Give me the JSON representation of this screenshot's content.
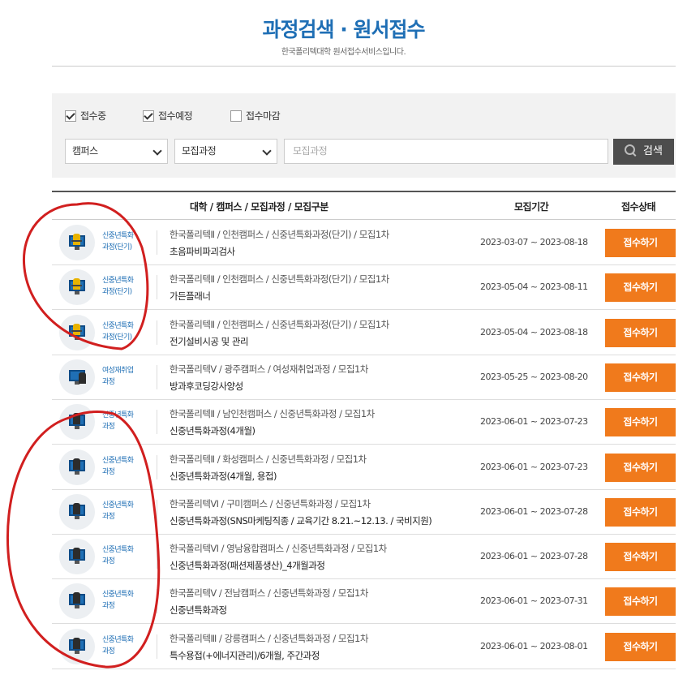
{
  "header": {
    "title": "과정검색 · 원서접수",
    "subtitle": "한국폴리텍대학 원서접수서비스입니다."
  },
  "search": {
    "checkboxes": [
      {
        "label": "접수중",
        "checked": true
      },
      {
        "label": "접수예정",
        "checked": true
      },
      {
        "label": "접수마감",
        "checked": false
      }
    ],
    "campus_select": "캠퍼스",
    "course_select": "모집과정",
    "keyword_placeholder": "모집과정",
    "button_label": "검색"
  },
  "table": {
    "headers": [
      "대학 / 캠퍼스 / 모집과정 / 모집구분",
      "모집기간",
      "접수상태"
    ],
    "rows": [
      {
        "icon": "graduate-icon",
        "category": [
          "신중년특화",
          "과정(단기)"
        ],
        "path": "한국폴리텍Ⅱ  / 인천캠퍼스  /  신중년특화과정(단기)  / 모집1차",
        "course": "초음파비파괴검사",
        "period": "2023-03-07 ~ 2023-08-18",
        "status": "접수하기"
      },
      {
        "icon": "graduate-icon",
        "category": [
          "신중년특화",
          "과정(단기)"
        ],
        "path": "한국폴리텍Ⅱ  / 인천캠퍼스  /  신중년특화과정(단기)  / 모집1차",
        "course": "가든플래너",
        "period": "2023-05-04 ~ 2023-08-11",
        "status": "접수하기"
      },
      {
        "icon": "graduate-icon",
        "category": [
          "신중년특화",
          "과정(단기)"
        ],
        "path": "한국폴리텍Ⅱ  / 인천캠퍼스  /  신중년특화과정(단기)  / 모집1차",
        "course": "전기설비시공 및 관리",
        "period": "2023-05-04 ~ 2023-08-18",
        "status": "접수하기"
      },
      {
        "icon": "woman-monitor-icon",
        "category": [
          "여성재취업",
          "과정"
        ],
        "path": "한국폴리텍Ⅴ  / 광주캠퍼스  /  여성재취업과정  / 모집1차",
        "course": "방과후코딩강사양성",
        "period": "2023-05-25 ~ 2023-08-20",
        "status": "접수하기"
      },
      {
        "icon": "monitor-icon",
        "category": [
          "신중년특화",
          "과정"
        ],
        "path": "한국폴리텍Ⅱ  / 남인천캠퍼스  /  신중년특화과정  / 모집1차",
        "course": "신중년특화과정(4개월)",
        "period": "2023-06-01 ~ 2023-07-23",
        "status": "접수하기"
      },
      {
        "icon": "monitor-icon",
        "category": [
          "신중년특화",
          "과정"
        ],
        "path": "한국폴리텍Ⅱ  / 화성캠퍼스  /  신중년특화과정  / 모집1차",
        "course": "신중년특화과정(4개월, 용접)",
        "period": "2023-06-01 ~ 2023-07-23",
        "status": "접수하기"
      },
      {
        "icon": "monitor-icon",
        "category": [
          "신중년특화",
          "과정"
        ],
        "path": "한국폴리텍Ⅵ  / 구미캠퍼스  /  신중년특화과정  / 모집1차",
        "course": "신중년특화과정(SNS마케팅직종 / 교육기간 8.21.~12.13. / 국비지원)",
        "period": "2023-06-01 ~ 2023-07-28",
        "status": "접수하기"
      },
      {
        "icon": "monitor-icon",
        "category": [
          "신중년특화",
          "과정"
        ],
        "path": "한국폴리텍Ⅵ  / 영남융합캠퍼스  /  신중년특화과정  / 모집1차",
        "course": "신중년특화과정(패션제품생산)_4개월과정",
        "period": "2023-06-01 ~ 2023-07-28",
        "status": "접수하기"
      },
      {
        "icon": "monitor-icon",
        "category": [
          "신중년특화",
          "과정"
        ],
        "path": "한국폴리텍Ⅴ  / 전남캠퍼스  /  신중년특화과정  / 모집1차",
        "course": "신중년특화과정",
        "period": "2023-06-01 ~ 2023-07-31",
        "status": "접수하기"
      },
      {
        "icon": "monitor-icon",
        "category": [
          "신중년특화",
          "과정"
        ],
        "path": "한국폴리텍Ⅲ  / 강릉캠퍼스  /  신중년특화과정  / 모집1차",
        "course": "특수용접(+에너지관리)/6개월, 주간과정",
        "period": "2023-06-01 ~ 2023-08-01",
        "status": "접수하기"
      }
    ]
  },
  "colors": {
    "title": "#1f6fb5",
    "apply_button": "#f07a1c",
    "search_button": "#4d4d4d",
    "annotation": "#d11f1f"
  }
}
